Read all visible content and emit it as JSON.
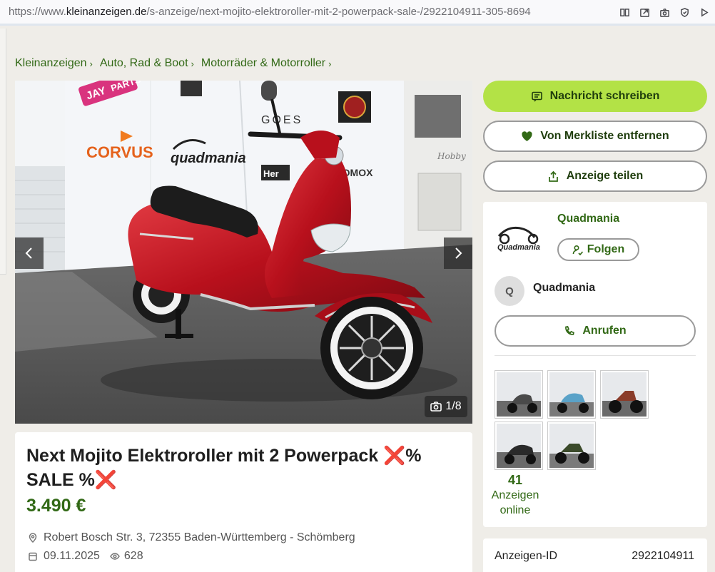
{
  "browser": {
    "url_prefix": "https://www.",
    "url_host": "kleinanzeigen.de",
    "url_path": "/s-anzeige/next-mojito-elektroroller-mit-2-powerpack-sale-/2922104911-305-8694",
    "icons": [
      "reader-icon",
      "share-icon",
      "camera-icon",
      "shield-icon",
      "forward-icon"
    ]
  },
  "breadcrumb": [
    {
      "label": "Kleinanzeigen"
    },
    {
      "label": "Auto, Rad & Boot"
    },
    {
      "label": "Motorräder & Motorroller"
    }
  ],
  "gallery": {
    "counter": "1/8",
    "prev_icon": "chevron-left-icon",
    "next_icon": "chevron-right-icon",
    "wall_texts": [
      "JAY",
      "PARTS",
      "CORVUS",
      "quadmania",
      "GOES",
      "Her",
      "TROMOX",
      "Hobby"
    ]
  },
  "ad": {
    "title": "Next Mojito Elektroroller mit 2 Powerpack ❌% SALE %❌",
    "price": "3.490 €",
    "location": "Robert Bosch Str. 3, 72355 Baden-Württemberg - Schömberg",
    "date": "09.11.2025",
    "views": "628"
  },
  "actions": {
    "message": "Nachricht schreiben",
    "watchlist": "Von Merkliste entfernen",
    "share": "Anzeige teilen"
  },
  "seller": {
    "store_name": "Quadmania",
    "logo_text": "Quadmania",
    "follow": "Folgen",
    "avatar_initial": "Q",
    "contact_name": "Quadmania",
    "call": "Anrufen",
    "ads_count": "41",
    "ads_label_1": "Anzeigen",
    "ads_label_2": "online"
  },
  "details": {
    "id_label": "Anzeigen-ID",
    "id_value": "2922104911"
  },
  "colors": {
    "brand_green": "#326916",
    "button_lime": "#b3e246",
    "scooter_red": "#c2121f"
  }
}
